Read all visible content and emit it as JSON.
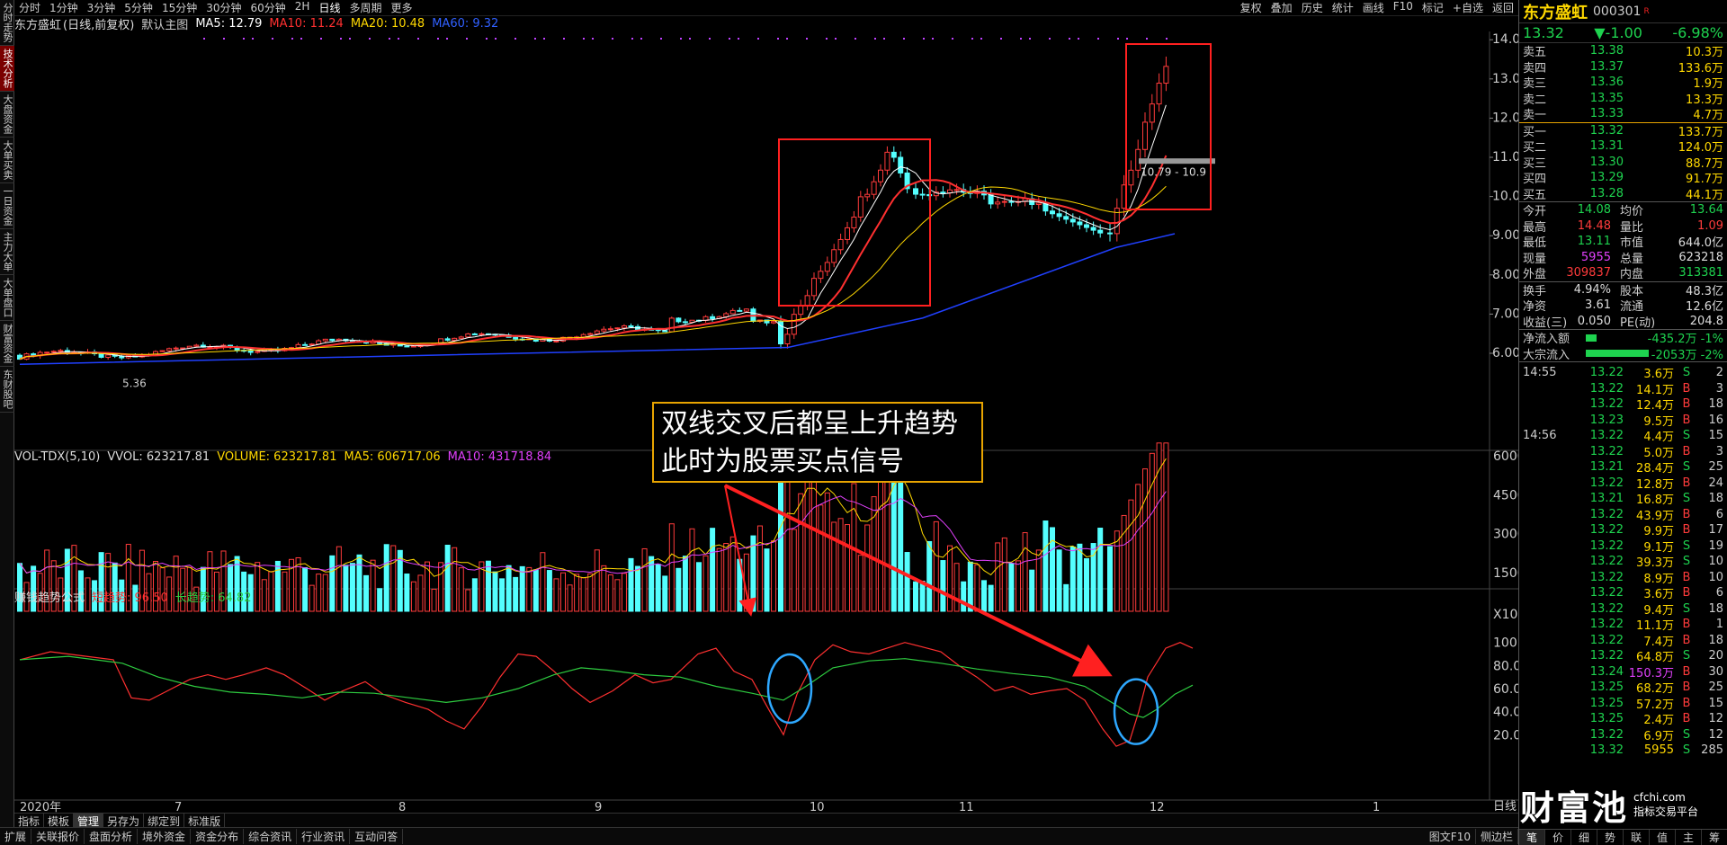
{
  "left_tabs": [
    "分时走势",
    "技术分析",
    "大盘资金",
    "大单买卖",
    "一日资金",
    "主力大单",
    "大单盘口",
    "财富资金",
    "东财股吧"
  ],
  "topbar": {
    "periods": [
      "分时",
      "1分钟",
      "3分钟",
      "5分钟",
      "15分钟",
      "30分钟",
      "60分钟",
      "2H",
      "日线",
      "多周期",
      "更多"
    ],
    "active_period": "日线",
    "tools": [
      "复权",
      "叠加",
      "历史",
      "统计",
      "画线",
      "F10",
      "标记",
      "+自选",
      "返回"
    ]
  },
  "info": {
    "name": "东方盛虹",
    "mode": "(日线,前复权)",
    "main_label": "默认主图",
    "ma5": "MA5: 12.79",
    "ma10": "MA10: 11.24",
    "ma20": "MA20: 10.48",
    "ma60": "MA60: 9.32"
  },
  "price_axis": [
    "14.00",
    "13.00",
    "12.00",
    "11.00",
    "10.00",
    "9.00",
    "8.00",
    "7.00",
    "6.00"
  ],
  "price_marks": {
    "high": "14.48",
    "low": "5.36",
    "range": "10.79 - 10.9"
  },
  "vol": {
    "label": "VOL-TDX(5,10)",
    "vvol": "VVOL: 623217.81",
    "volume": "VOLUME: 623217.81",
    "ma5": "MA5: 606717.06",
    "ma10": "MA10: 431718.84",
    "axis": [
      "60000",
      "45000",
      "30000",
      "15000",
      "X10"
    ]
  },
  "ind": {
    "name": "赚钱趋势公式",
    "short": "短趋势: 96.50",
    "long": "长趋势: 64.82",
    "axis": [
      "100.0",
      "80.00",
      "60.00",
      "40.00",
      "20.00"
    ]
  },
  "time_axis": {
    "year": "2020年",
    "months": [
      "7",
      "8",
      "9",
      "10",
      "11",
      "12",
      "1"
    ],
    "mode": "日线"
  },
  "annotation": {
    "line1": "双线交叉后都呈上升趋势",
    "line2": "此时为股票买点信号"
  },
  "bottom_tabs": [
    "指标",
    "模板",
    "管理",
    "另存为",
    "绑定到",
    "标准版"
  ],
  "status": [
    "扩展",
    "关联报价",
    "盘面分析",
    "境外资金",
    "资金分布",
    "综合资讯",
    "行业资讯",
    "互动问答"
  ],
  "status_right": [
    "图文F10",
    "侧边栏"
  ],
  "watermark": {
    "main": "财富池",
    "site": "cfchi.com",
    "sub": "指标交易平台"
  },
  "quote": {
    "name": "东方盛虹",
    "code": "000301",
    "badge": "R",
    "price": "13.32",
    "change": "▼-1.00",
    "pct": "-6.98%",
    "asks": [
      {
        "l": "卖五",
        "p": "13.38",
        "v": "10.3万"
      },
      {
        "l": "卖四",
        "p": "13.37",
        "v": "133.6万"
      },
      {
        "l": "卖三",
        "p": "13.36",
        "v": "1.9万"
      },
      {
        "l": "卖二",
        "p": "13.35",
        "v": "13.3万"
      },
      {
        "l": "卖一",
        "p": "13.33",
        "v": "4.7万"
      }
    ],
    "bids": [
      {
        "l": "买一",
        "p": "13.32",
        "v": "133.7万"
      },
      {
        "l": "买二",
        "p": "13.31",
        "v": "124.0万"
      },
      {
        "l": "买三",
        "p": "13.30",
        "v": "88.7万"
      },
      {
        "l": "买四",
        "p": "13.29",
        "v": "91.7万"
      },
      {
        "l": "买五",
        "p": "13.28",
        "v": "44.1万"
      }
    ],
    "stats": [
      [
        "今开",
        "14.08",
        "均价",
        "13.64"
      ],
      [
        "最高",
        "14.48",
        "量比",
        "1.09"
      ],
      [
        "最低",
        "13.11",
        "市值",
        "644.0亿"
      ],
      [
        "现量",
        "5955",
        "总量",
        "623218"
      ],
      [
        "外盘",
        "309837",
        "内盘",
        "313381"
      ]
    ],
    "stats2": [
      [
        "换手",
        "4.94%",
        "股本",
        "48.3亿"
      ],
      [
        "净资",
        "3.61",
        "流通",
        "12.6亿"
      ],
      [
        "收益(三)",
        "0.050",
        "PE(动)",
        "204.8"
      ]
    ],
    "flows": [
      {
        "k": "净流入额",
        "v": "-435.2万 -1%",
        "w": 12
      },
      {
        "k": "大宗流入",
        "v": "-2053万 -2%",
        "w": 70
      }
    ],
    "ticks": [
      [
        "14:55",
        "13.22",
        "3.6万",
        "S",
        "2"
      ],
      [
        "",
        "13.22",
        "14.1万",
        "B",
        "3"
      ],
      [
        "",
        "13.22",
        "12.4万",
        "B",
        "18"
      ],
      [
        "",
        "13.23",
        "9.5万",
        "B",
        "16"
      ],
      [
        "14:56",
        "13.22",
        "4.4万",
        "S",
        "15"
      ],
      [
        "",
        "13.22",
        "5.0万",
        "B",
        "3"
      ],
      [
        "",
        "13.21",
        "28.4万",
        "S",
        "25"
      ],
      [
        "",
        "13.22",
        "12.8万",
        "B",
        "24"
      ],
      [
        "",
        "13.21",
        "16.8万",
        "S",
        "18"
      ],
      [
        "",
        "13.22",
        "43.9万",
        "B",
        "6"
      ],
      [
        "",
        "13.22",
        "9.9万",
        "B",
        "17"
      ],
      [
        "",
        "13.22",
        "9.1万",
        "S",
        "19"
      ],
      [
        "",
        "13.22",
        "39.3万",
        "S",
        "10"
      ],
      [
        "",
        "13.22",
        "8.9万",
        "B",
        "10"
      ],
      [
        "",
        "13.22",
        "3.6万",
        "B",
        "6"
      ],
      [
        "",
        "13.22",
        "9.4万",
        "S",
        "18"
      ],
      [
        "",
        "13.22",
        "11.1万",
        "B",
        "1"
      ],
      [
        "",
        "13.22",
        "7.4万",
        "B",
        "18"
      ],
      [
        "",
        "13.22",
        "64.8万",
        "S",
        "20"
      ],
      [
        "",
        "13.24",
        "150.3万",
        "B",
        "30"
      ],
      [
        "",
        "13.25",
        "68.2万",
        "B",
        "25"
      ],
      [
        "",
        "13.25",
        "57.2万",
        "B",
        "15"
      ],
      [
        "",
        "13.25",
        "2.4万",
        "B",
        "12"
      ],
      [
        "",
        "13.22",
        "6.9万",
        "S",
        "12"
      ],
      [
        "",
        "13.32",
        "5955",
        "S",
        "285"
      ]
    ],
    "rp_tabs": [
      "笔",
      "价",
      "细",
      "势",
      "联",
      "值",
      "主",
      "筹"
    ]
  }
}
